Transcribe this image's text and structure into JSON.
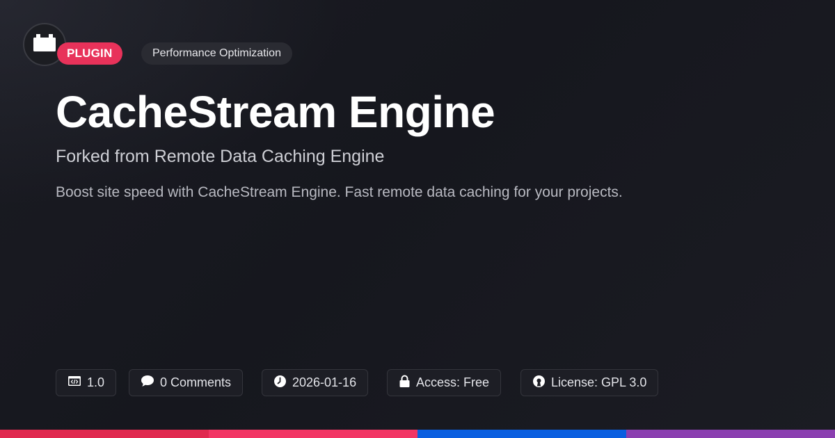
{
  "header": {
    "type_badge": "PLUGIN",
    "category_badge": "Performance Optimization"
  },
  "main": {
    "title": "CacheStream Engine",
    "subtitle": "Forked from Remote Data Caching Engine",
    "description": "Boost site speed with CacheStream Engine. Fast remote data caching for your projects."
  },
  "meta": {
    "version": "1.0",
    "comments": "0 Comments",
    "date": "2026-01-16",
    "access": "Access: Free",
    "license": "License: GPL 3.0"
  },
  "icons": {
    "logo": "plugin-block-icon",
    "version": "code-window-icon",
    "comments": "speech-bubble-icon",
    "date": "clock-icon",
    "access": "lock-icon",
    "license": "open-source-icon"
  },
  "colors": {
    "background": "#17181f",
    "accent": "#e8325a",
    "bottom_bar": [
      "#e0294f",
      "#f23564",
      "#0a5fe0",
      "#8a3fb0"
    ]
  }
}
